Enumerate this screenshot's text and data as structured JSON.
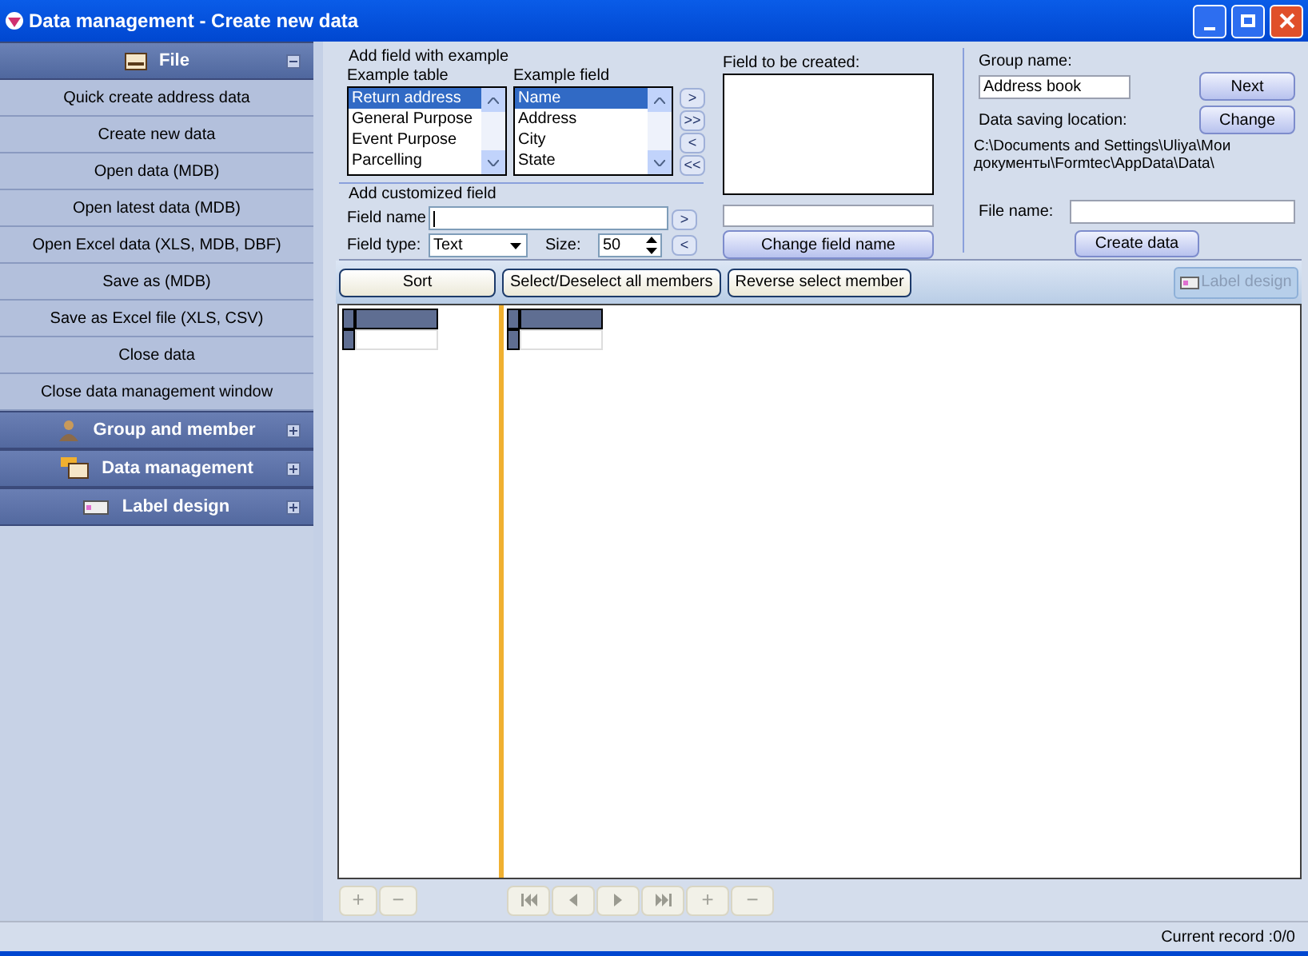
{
  "window": {
    "title": "Data management - Create new data"
  },
  "sidebar": {
    "sections": [
      {
        "label": "File",
        "kind": "file",
        "expanded": true,
        "items": [
          "Quick create address data",
          "Create new data",
          "Open data (MDB)",
          "Open latest data (MDB)",
          "Open Excel data (XLS, MDB, DBF)",
          "Save as (MDB)",
          "Save as Excel file (XLS, CSV)",
          "Close data",
          "Close data management window"
        ]
      },
      {
        "label": "Group and member",
        "kind": "group",
        "expanded": false
      },
      {
        "label": "Data management",
        "kind": "data",
        "expanded": false
      },
      {
        "label": "Label design",
        "kind": "label",
        "expanded": false
      }
    ]
  },
  "example": {
    "title": "Add field with example",
    "table_label": "Example table",
    "field_label": "Example field",
    "tables": [
      {
        "label": "Return address",
        "selected": true
      },
      {
        "label": "General Purpose",
        "selected": false
      },
      {
        "label": "Event Purpose",
        "selected": false
      },
      {
        "label": "Parcelling",
        "selected": false
      }
    ],
    "fields": [
      {
        "label": "Name",
        "selected": true
      },
      {
        "label": "Address",
        "selected": false
      },
      {
        "label": "City",
        "selected": false
      },
      {
        "label": "State",
        "selected": false
      }
    ],
    "move_buttons": [
      ">",
      ">>",
      "<",
      "<<"
    ]
  },
  "custom": {
    "title": "Add customized field",
    "field_name_label": "Field name",
    "field_type_label": "Field type:",
    "field_type": "Text",
    "size_label": "Size:",
    "size": "50",
    "move_buttons": [
      ">",
      "<"
    ]
  },
  "created": {
    "title": "Field to be created:",
    "rename_button": "Change field name"
  },
  "group": {
    "label": "Group name:",
    "value": "Address book",
    "next_button": "Next",
    "location_label": "Data saving location:",
    "change_button": "Change",
    "path": "C:\\Documents and Settings\\Uliya\\Мои документы\\Formtec\\AppData\\Data\\",
    "file_label": "File name:",
    "create_button": "Create data"
  },
  "toolbar": {
    "buttons": [
      "Sort",
      "Select/Deselect all members",
      "Reverse select member"
    ],
    "label_design": {
      "label": "Label design",
      "disabled": true
    }
  },
  "left_nav": [
    {
      "label": "+",
      "disabled": true
    },
    {
      "label": "−",
      "disabled": true
    }
  ],
  "right_nav": [
    {
      "kind": "first",
      "disabled": true
    },
    {
      "kind": "prev",
      "disabled": true
    },
    {
      "kind": "next",
      "disabled": true
    },
    {
      "kind": "last",
      "disabled": true
    },
    {
      "kind": "text",
      "label": "+",
      "disabled": true
    },
    {
      "kind": "text",
      "label": "−",
      "disabled": true
    }
  ],
  "status_bar": {
    "text": "Current record :0/0"
  }
}
